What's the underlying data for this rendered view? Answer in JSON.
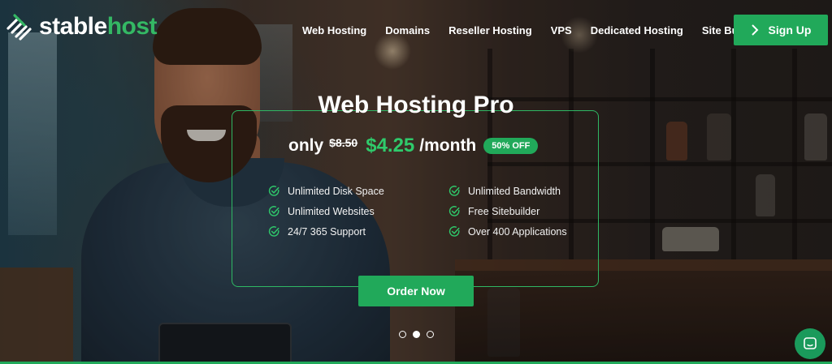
{
  "brand": {
    "name_part1": "stable",
    "name_part2": "host",
    "accent": "#21a95a"
  },
  "nav": {
    "items": [
      "Web Hosting",
      "Domains",
      "Reseller Hosting",
      "VPS",
      "Dedicated Hosting",
      "Site Builder"
    ],
    "signup_label": "Sign Up",
    "signup_icon": "chevron-right-icon"
  },
  "promo": {
    "title": "Web Hosting Pro",
    "price_prefix": "only",
    "old_price": "$8.50",
    "new_price": "$4.25",
    "per": "/month",
    "badge": "50% OFF",
    "features": [
      "Unlimited Disk Space",
      "Unlimited Bandwidth",
      "Unlimited Websites",
      "Free Sitebuilder",
      "24/7 365 Support",
      "Over 400 Applications"
    ],
    "feature_icon": "check-circle-icon",
    "order_label": "Order Now"
  },
  "slider": {
    "count": 3,
    "active": 2
  },
  "chat": {
    "icon": "chat-icon"
  }
}
